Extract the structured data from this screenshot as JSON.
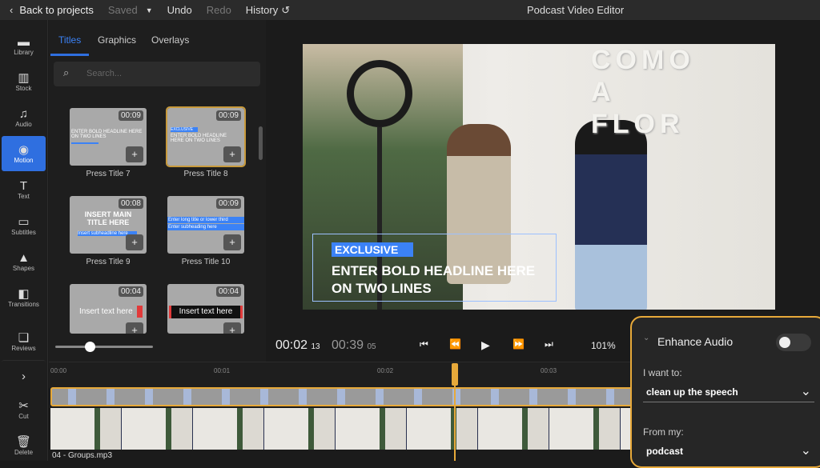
{
  "topbar": {
    "back": "Back to projects",
    "saved": "Saved",
    "undo": "Undo",
    "redo": "Redo",
    "history": "History",
    "title": "Podcast Video Editor"
  },
  "rail": [
    {
      "label": "Library",
      "icon": "folder-icon"
    },
    {
      "label": "Stock",
      "icon": "books-icon"
    },
    {
      "label": "Audio",
      "icon": "music-note-icon"
    },
    {
      "label": "Motion",
      "icon": "motion-icon",
      "active": true
    },
    {
      "label": "Text",
      "icon": "text-icon"
    },
    {
      "label": "Subtitles",
      "icon": "subtitles-icon"
    },
    {
      "label": "Shapes",
      "icon": "shapes-icon"
    },
    {
      "label": "Transitions",
      "icon": "transitions-icon"
    },
    {
      "label": "Reviews",
      "icon": "comments-icon"
    }
  ],
  "rail_bottom": {
    "cut": "Cut",
    "delete": "Delete"
  },
  "panel": {
    "tabs": [
      "Titles",
      "Graphics",
      "Overlays"
    ],
    "active_tab": "Titles",
    "search_placeholder": "Search...",
    "thumbs": [
      {
        "label": "Press Title 7",
        "duration": "00:09",
        "text": "ENTER BOLD HEADLINE HERE ON TWO LINES"
      },
      {
        "label": "Press Title 8",
        "duration": "00:09",
        "badge": "EXCLUSIVE",
        "text": "ENTER BOLD HEADLINE HERE ON TWO LINES",
        "selected": true
      },
      {
        "label": "Press Title 9",
        "duration": "00:08",
        "text": "INSERT MAIN TITLE HERE",
        "sub": "Insert subheadline here"
      },
      {
        "label": "Press Title 10",
        "duration": "00:09",
        "text": "Enter long title or lower third",
        "sub": "Enter subheading here"
      },
      {
        "label": "",
        "duration": "00:04",
        "text": "Insert text here"
      },
      {
        "label": "",
        "duration": "00:04",
        "text": "Insert text here"
      }
    ],
    "zoom_slider": 0.35
  },
  "preview": {
    "badge": "EXCLUSIVE",
    "headline1": "ENTER BOLD HEADLINE HERE",
    "headline2": "ON TWO LINES",
    "wall_text": "COMO A FLOR"
  },
  "controls": {
    "current": "00:02",
    "current_frames": "13",
    "total": "00:39",
    "total_frames": "05",
    "zoom": "101%"
  },
  "timeline": {
    "ticks": [
      "00:00",
      "00:01",
      "00:02",
      "00:03"
    ],
    "audio_track": "04 - Groups.mp3"
  },
  "enhance": {
    "title": "Enhance Audio",
    "enabled": false,
    "want_label": "I want to:",
    "want_value": "clean up the speech",
    "from_label": "From my:",
    "from_value": "podcast"
  },
  "colors": {
    "accent": "#2f6fe0",
    "highlight": "#e7a93a"
  }
}
